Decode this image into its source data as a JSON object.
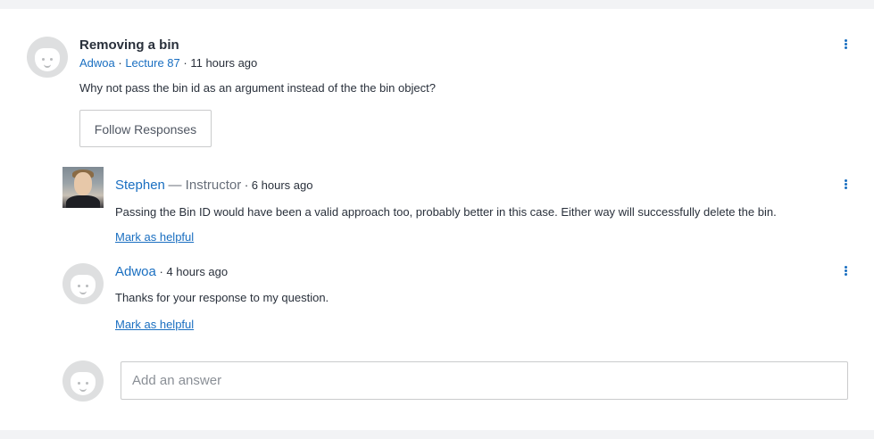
{
  "question": {
    "title": "Removing a bin",
    "author": "Adwoa",
    "lecture": "Lecture 87",
    "time": "11 hours ago",
    "body": "Why not pass the bin id as an argument instead of the the bin object?",
    "follow_label": "Follow Responses"
  },
  "responses": [
    {
      "author": "Stephen",
      "role": "— Instructor",
      "time": "6 hours ago",
      "body": "Passing the Bin ID would have been a valid approach too, probably better in this case.  Either way will successfully delete the bin.",
      "helpful_label": "Mark as helpful"
    },
    {
      "author": "Adwoa",
      "role": "",
      "time": "4 hours ago",
      "body": "Thanks for your response to my question.",
      "helpful_label": "Mark as helpful"
    }
  ],
  "answer": {
    "placeholder": "Add an answer"
  },
  "colors": {
    "link": "#1a6fc1",
    "text": "#29303b",
    "avatar_bg": "#dedfe0"
  },
  "icons": {
    "more": "kebab-menu-icon",
    "default_avatar": "default-avatar-icon"
  }
}
